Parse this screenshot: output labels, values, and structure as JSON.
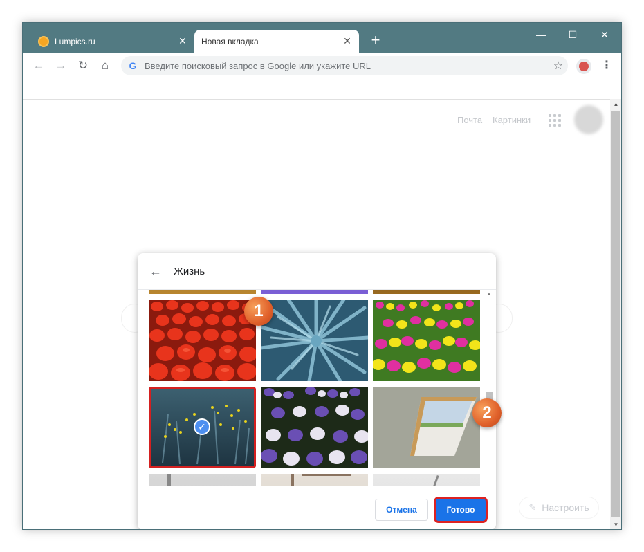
{
  "tabs": [
    {
      "label": "Lumpics.ru",
      "active": false
    },
    {
      "label": "Новая вкладка",
      "active": true
    }
  ],
  "new_tab_symbol": "+",
  "window_controls": {
    "minimize": "—",
    "maximize": "☐",
    "close": "✕"
  },
  "omnibox": {
    "placeholder": "Введите поисковый запрос в Google или укажите URL"
  },
  "ntp": {
    "links": [
      "Почта",
      "Картинки"
    ],
    "customize_label": "Настроить"
  },
  "dialog": {
    "title": "Жизнь",
    "cancel_label": "Отмена",
    "done_label": "Готово",
    "selected_image": "blue-plants-yellow-flowers"
  },
  "annotations": {
    "step1": "1",
    "step2": "2"
  },
  "colors": {
    "titlebar": "#527a82",
    "accent": "#1a73e8",
    "highlight": "#dd2222",
    "badge": "#e8722f"
  }
}
